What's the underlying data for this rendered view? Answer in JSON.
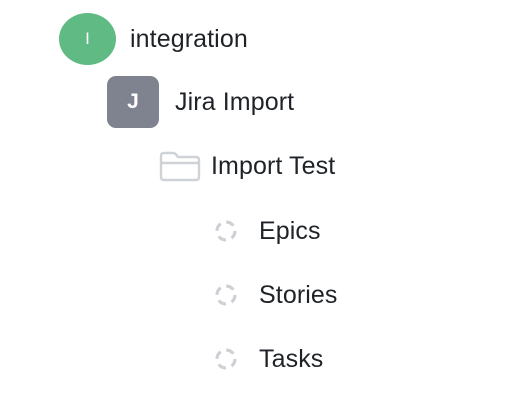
{
  "workspace": {
    "avatar_letter": "I",
    "name": "integration",
    "avatar_color": "#5fba84"
  },
  "project": {
    "avatar_letter": "J",
    "name": "Jira Import",
    "avatar_color": "#7f8390"
  },
  "folder": {
    "name": "Import Test",
    "icon": "folder-icon"
  },
  "items": [
    {
      "label": "Epics",
      "icon": "dashed-circle-status-icon"
    },
    {
      "label": "Stories",
      "icon": "dashed-circle-status-icon"
    },
    {
      "label": "Tasks",
      "icon": "dashed-circle-status-icon"
    }
  ]
}
